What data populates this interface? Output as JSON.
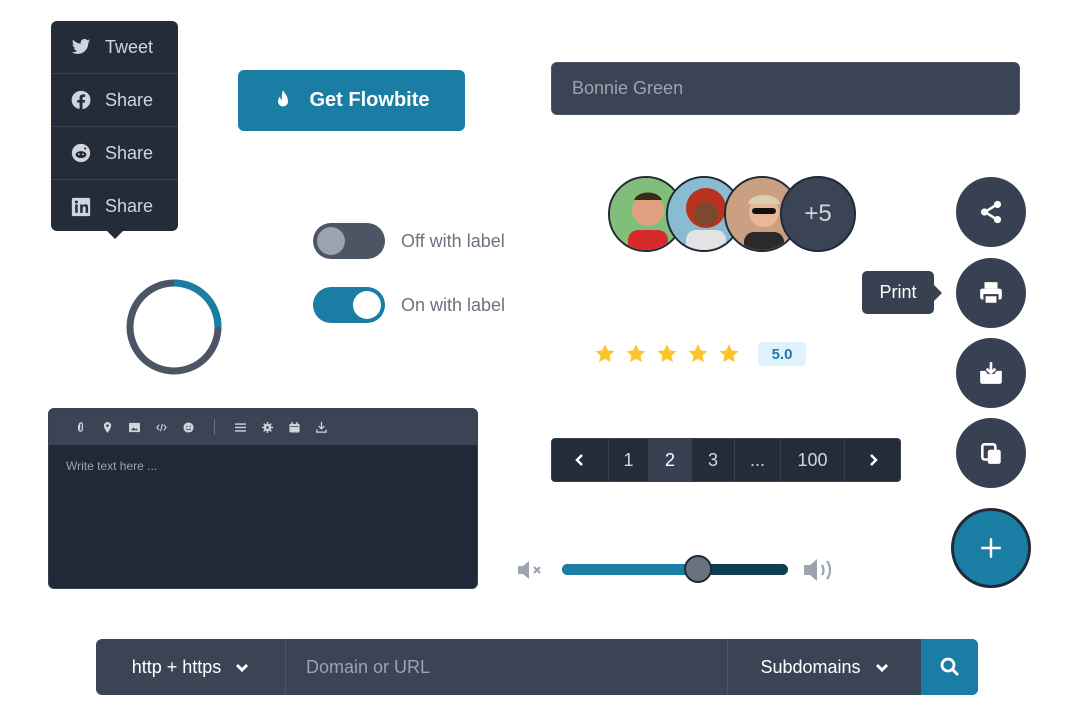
{
  "share_menu": {
    "items": [
      {
        "label": "Tweet",
        "icon": "twitter-icon"
      },
      {
        "label": "Share",
        "icon": "facebook-icon"
      },
      {
        "label": "Share",
        "icon": "reddit-icon"
      },
      {
        "label": "Share",
        "icon": "linkedin-icon"
      }
    ]
  },
  "cta": {
    "label": "Get Flowbite",
    "icon": "fire-icon",
    "color": "#1a7ea4"
  },
  "name_input": {
    "value": "Bonnie Green"
  },
  "progress_ring": {
    "fraction": 0.25,
    "track_color": "#4b5563",
    "fill_color": "#1a7ea4"
  },
  "toggles": [
    {
      "label": "Off with label",
      "checked": false
    },
    {
      "label": "On with label",
      "checked": true
    }
  ],
  "avatars": {
    "more_label": "+5"
  },
  "rating": {
    "stars": 5,
    "max": 5,
    "badge": "5.0",
    "star_color": "#fcc42d"
  },
  "speed_dial": {
    "tooltip": "Print",
    "actions": [
      "share-icon",
      "printer-icon",
      "download-icon",
      "copy-icon"
    ],
    "main": "plus-icon"
  },
  "editor": {
    "placeholder": "Write text here ...",
    "toolbar": [
      "attach-icon",
      "map-pin-icon",
      "image-icon",
      "code-icon",
      "emoji-icon",
      "list-icon",
      "settings-icon",
      "calendar-icon",
      "download-icon"
    ]
  },
  "pagination": {
    "pages": [
      "1",
      "2",
      "3",
      "...",
      "100"
    ],
    "active": "2"
  },
  "volume": {
    "level": 0.6
  },
  "search_bar": {
    "protocol": "http + https",
    "placeholder": "Domain or URL",
    "scope": "Subdomains"
  }
}
